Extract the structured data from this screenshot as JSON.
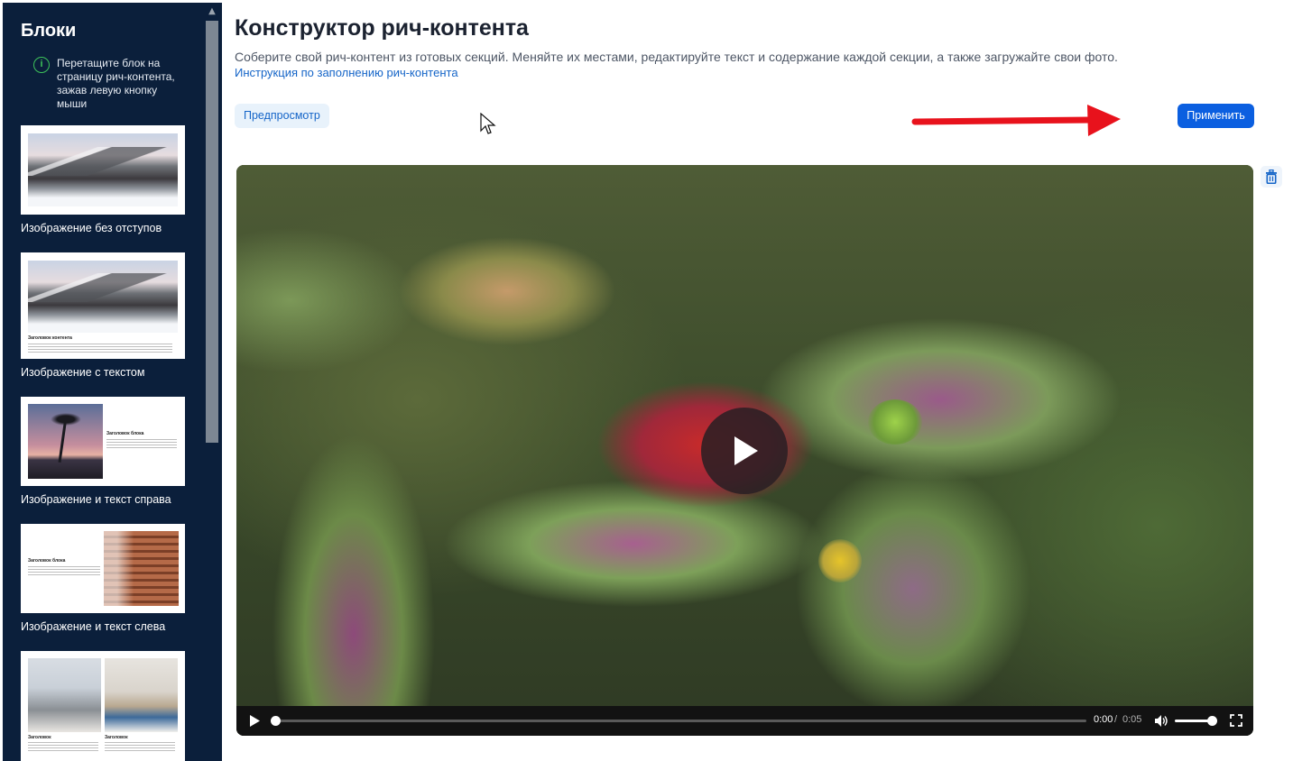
{
  "sidebar": {
    "title": "Блоки",
    "hint": "Перетащите блок на страницу рич-контента, зажав левую кнопку мыши",
    "hint_icon": "info-icon",
    "blocks": [
      {
        "label": "Изображение без отступов"
      },
      {
        "label": "Изображение с текстом",
        "thumb_title": "Заголовок контента"
      },
      {
        "label": "Изображение и текст справа",
        "thumb_title": "Заголовок блока"
      },
      {
        "label": "Изображение и текст слева",
        "thumb_title": "Заголовок блока"
      },
      {
        "label": "",
        "thumb_title_left": "Заголовок",
        "thumb_title_right": "Заголовок"
      }
    ]
  },
  "main": {
    "title": "Конструктор рич-контента",
    "description": "Соберите свой рич-контент из готовых секций. Меняйте их местами, редактируйте текст и содержание каждой секции, а также загружайте свои фото.",
    "link": "Инструкция по заполнению рич-контента",
    "preview_label": "Предпросмотр",
    "apply_label": "Применить",
    "delete_icon": "trash-icon",
    "video": {
      "current_time": "0:00",
      "separator": "/",
      "duration": "0:05",
      "progress": 0,
      "volume": 0.9
    }
  },
  "colors": {
    "sidebar_bg": "#0b1f3b",
    "accent": "#0b5fe0",
    "link": "#1565c8",
    "annotation_arrow": "#e8121c"
  }
}
